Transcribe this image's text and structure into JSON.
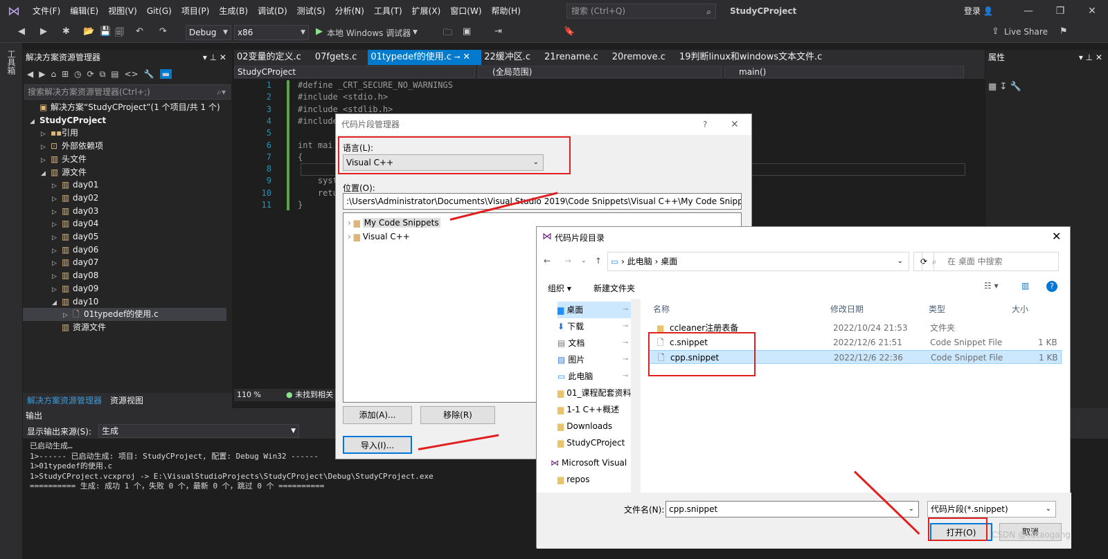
{
  "titlebar": {
    "menu": [
      "文件(F)",
      "编辑(E)",
      "视图(V)",
      "Git(G)",
      "项目(P)",
      "生成(B)",
      "调试(D)",
      "测试(S)",
      "分析(N)",
      "工具(T)",
      "扩展(X)",
      "窗口(W)",
      "帮助(H)"
    ],
    "search_placeholder": "搜索 (Ctrl+Q)",
    "project": "StudyCProject",
    "login": "登录",
    "live_share": "Live Share"
  },
  "toolbar": {
    "config": "Debug",
    "platform": "x86",
    "run_label": "本地 Windows 调试器"
  },
  "toolstrip": {
    "label": "工具箱"
  },
  "solution_explorer": {
    "title": "解决方案资源管理器",
    "search_placeholder": "搜索解决方案资源管理器(Ctrl+;)",
    "solution": "解决方案“StudyCProject”(1 个项目/共 1 个)",
    "project": "StudyCProject",
    "items": [
      "引用",
      "外部依赖项",
      "头文件",
      "源文件"
    ],
    "days": [
      "day01",
      "day02",
      "day03",
      "day04",
      "day05",
      "day06",
      "day07",
      "day08",
      "day09",
      "day10"
    ],
    "file": "01typedef的使用.c",
    "resources": "资源文件",
    "tabs": [
      "解决方案资源管理器",
      "资源视图"
    ]
  },
  "editor": {
    "tabs": [
      "02变量的定义.c",
      "07fgets.c",
      "01typedef的使用.c",
      "22缓冲区.c",
      "21rename.c",
      "20remove.c",
      "19判断linux和windows文本文件.c"
    ],
    "active_tab": 2,
    "nav_project": "StudyCProject",
    "nav_scope": "(全局范围)",
    "nav_func": "main()",
    "line_numbers": [
      "1",
      "2",
      "3",
      "4",
      "5",
      "6",
      "7",
      "8",
      "9",
      "10",
      "11"
    ],
    "code": [
      "#define _CRT_SECURE_NO_WARNINGS",
      "#include <stdio.h>",
      "#include <stdlib.h>",
      "#include",
      "",
      "int mai",
      "{",
      "",
      "    syst",
      "    retu",
      "}"
    ],
    "zoom": "110 %",
    "status": "未找到相关"
  },
  "output": {
    "title": "输出",
    "source_label": "显示输出来源(S):",
    "source_value": "生成",
    "lines": [
      "已启动生成…",
      "1>------ 已启动生成: 项目: StudyCProject, 配置: Debug Win32 ------",
      "1>01typedef的使用.c",
      "1>StudyCProject.vcxproj -> E:\\VisualStudioProjects\\StudyCProject\\Debug\\StudyCProject.exe",
      "========== 生成: 成功 1 个，失败 0 个，最新 0 个，跳过 0 个 =========="
    ]
  },
  "properties": {
    "title": "属性"
  },
  "snippet_manager": {
    "title": "代码片段管理器",
    "help": "?",
    "language_label": "语言(L):",
    "language_value": "Visual C++",
    "location_label": "位置(O):",
    "location_value": ":\\Users\\Administrator\\Documents\\Visual Studio 2019\\Code Snippets\\Visual C++\\My Code Snippets",
    "tree": [
      "My Code Snippets",
      "Visual C++"
    ],
    "add": "添加(A)...",
    "remove": "移除(R)",
    "import": "导入(I)..."
  },
  "file_dialog": {
    "title": "代码片段目录",
    "breadcrumb": [
      "此电脑",
      "桌面"
    ],
    "search_placeholder": "在 桌面 中搜索",
    "organize": "组织",
    "new_folder": "新建文件夹",
    "nav": [
      "桌面",
      "下载",
      "文档",
      "图片",
      "此电脑",
      "01_课程配套资料",
      "1-1 C++概述",
      "Downloads",
      "StudyCProject",
      "Microsoft Visual",
      "repos"
    ],
    "columns": [
      "名称",
      "修改日期",
      "类型",
      "大小"
    ],
    "files": [
      {
        "name": "ccleaner注册表备",
        "date": "2022/10/24 21:53",
        "type": "文件夹",
        "size": ""
      },
      {
        "name": "c.snippet",
        "date": "2022/12/6 21:51",
        "type": "Code Snippet File",
        "size": "1 KB"
      },
      {
        "name": "cpp.snippet",
        "date": "2022/12/6 22:36",
        "type": "Code Snippet File",
        "size": "1 KB"
      }
    ],
    "filename_label": "文件名(N):",
    "filename_value": "cpp.snippet",
    "filter": "代码片段(*.snippet)",
    "open": "打开(O)",
    "cancel": "取消"
  },
  "watermark": "CSDN @cdtaogang"
}
